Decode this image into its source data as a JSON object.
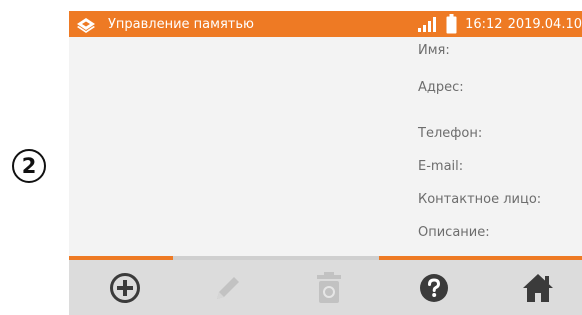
{
  "step_marker": "2",
  "status_bar": {
    "title": "Управление памятью",
    "time": "16:12",
    "date": "2019.04.10"
  },
  "details": {
    "name_label": "Имя:",
    "address_label": "Адрес:",
    "phone_label": "Телефон:",
    "email_label": "E-mail:",
    "contact_label": "Контактное лицо:",
    "description_label": "Описание:"
  },
  "toolbar": {
    "icons": [
      "plus-circle-icon",
      "pencil-icon",
      "trash-icon",
      "help-icon",
      "home-icon"
    ],
    "enabled": [
      true,
      false,
      false,
      true,
      true
    ]
  },
  "colors": {
    "accent": "#ee7a24",
    "background": "#f3f3f3",
    "toolbar": "#dcdcdc",
    "label_text": "#6d6d6d",
    "icon_dark": "#3b3b3b",
    "icon_disabled": "#c2c2c2"
  }
}
